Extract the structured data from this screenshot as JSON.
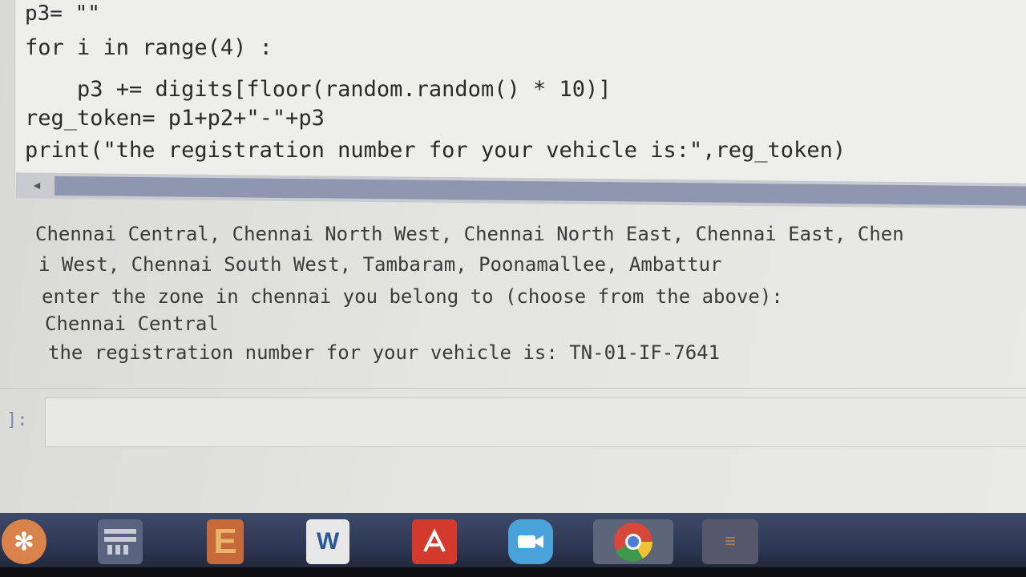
{
  "code": {
    "line1": "p3= \"\"",
    "line2": "for i in range(4) :",
    "line3": "    p3 += digits[floor(random.random() * 10)]",
    "line4": "reg_token= p1+p2+\"-\"+p3",
    "line5": "print(\"the registration number for your vehicle is:\",reg_token)"
  },
  "output": {
    "line1": "Chennai Central, Chennai North West, Chennai North East, Chennai East, Chen",
    "line2": "i West, Chennai South West, Tambaram, Poonamallee, Ambattur",
    "line3": "enter the zone in chennai you belong to (choose from the above):",
    "line4": "Chennai Central",
    "line5": "the registration number for your vehicle is: TN-01-IF-7641"
  },
  "prompt": "]:",
  "taskbar": {
    "icons": [
      "snowflake-app-icon",
      "calculator-icon",
      "e-app-icon",
      "word-icon",
      "acrobat-icon",
      "zoom-icon",
      "chrome-icon",
      "app-icon"
    ],
    "word_label": "W"
  },
  "colors": {
    "output_text": "#3b3b3b",
    "string": "#b5363a",
    "operator": "#9a4fd0",
    "scrollbar": "#8f96b0",
    "taskbar": "#2c3550"
  }
}
